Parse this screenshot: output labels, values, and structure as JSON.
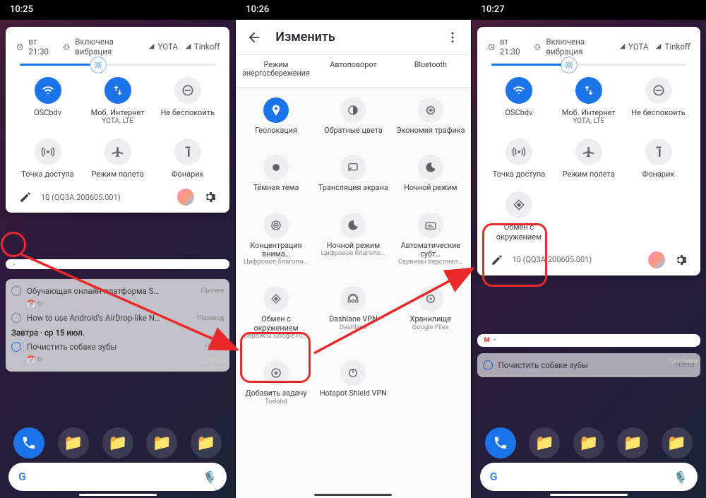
{
  "screen1": {
    "time": "10:25",
    "status": {
      "alarm": "вт 21:30",
      "vibration": "Включена вибрация",
      "carrier1": "YOTA",
      "carrier2": "Tinkoff"
    },
    "tiles": [
      {
        "icon": "wifi",
        "label": "OSCbdv",
        "sub": "",
        "on": true
      },
      {
        "icon": "data",
        "label": "Моб. Интернет",
        "sub": "YOTA, LTE",
        "on": true
      },
      {
        "icon": "dnd",
        "label": "Не беспокоить",
        "sub": "",
        "on": false
      },
      {
        "icon": "hotspot",
        "label": "Точка доступа",
        "sub": "",
        "on": false
      },
      {
        "icon": "airplane",
        "label": "Режим полета",
        "sub": "",
        "on": false
      },
      {
        "icon": "flashlight",
        "label": "Фонарик",
        "sub": "",
        "on": false
      }
    ],
    "build": "10 (QQ3A.200605.001)",
    "tasks": {
      "row1": "Обучающая онлайн-платформа S…",
      "row2": "How to use Android's AirDrop-like N…",
      "row2_meta": "Перевод",
      "date": "Завтра · ср 15 июл.",
      "row3": "Почистить собаке зубы",
      "row3_meta": "Нотка",
      "inbox": "Прочее"
    },
    "system_label": "Система"
  },
  "screen2": {
    "time": "10:26",
    "title": "Изменить",
    "top_row": [
      "Режим энергосбережения",
      "Автоповорот",
      "Bluetooth"
    ],
    "tiles": [
      {
        "icon": "location",
        "label": "Геолокация",
        "sub": "",
        "on": true
      },
      {
        "icon": "invert",
        "label": "Обратные цвета",
        "sub": ""
      },
      {
        "icon": "datasaver",
        "label": "Экономия трафика",
        "sub": ""
      },
      {
        "icon": "dark",
        "label": "Тёмная тема",
        "sub": ""
      },
      {
        "icon": "cast",
        "label": "Трансляция экрана",
        "sub": ""
      },
      {
        "icon": "night",
        "label": "Ночной режим",
        "sub": ""
      },
      {
        "icon": "focus",
        "label": "Концентрация внима…",
        "sub": "Цифровое благопол…"
      },
      {
        "icon": "night2",
        "label": "Ночной режим",
        "sub": "Цифровое благопол…"
      },
      {
        "icon": "caption",
        "label": "Автоматические субт…",
        "sub": "Сервисы персонализ…"
      },
      {
        "icon": "nearby",
        "label": "Обмен с окружением",
        "sub": "Сервисы Google Pla…"
      },
      {
        "icon": "vpn",
        "label": "Dashlane VPN",
        "sub": "Dashlane"
      },
      {
        "icon": "storage",
        "label": "Хранилище",
        "sub": "Google Files"
      },
      {
        "icon": "add",
        "label": "Добавить задачу",
        "sub": "Todoist"
      },
      {
        "icon": "power",
        "label": "Hotspot Shield VPN",
        "sub": ""
      }
    ]
  },
  "screen3": {
    "time": "10:27",
    "status": {
      "alarm": "вт 21:30",
      "vibration": "Включена вибрация",
      "carrier1": "YOTA",
      "carrier2": "Tinkoff"
    },
    "tiles": [
      {
        "icon": "wifi",
        "label": "OSCbdv",
        "sub": "",
        "on": true
      },
      {
        "icon": "data",
        "label": "Моб. Интернет",
        "sub": "YOTA, LTE",
        "on": true
      },
      {
        "icon": "dnd",
        "label": "Не беспокоить",
        "sub": "",
        "on": false
      },
      {
        "icon": "hotspot",
        "label": "Точка доступа",
        "sub": "",
        "on": false
      },
      {
        "icon": "airplane",
        "label": "Режим полета",
        "sub": "",
        "on": false
      },
      {
        "icon": "flashlight",
        "label": "Фонарик",
        "sub": "",
        "on": false
      }
    ],
    "nearby": {
      "label": "Обмен с окружением"
    },
    "build": "10 (QQ3A.200605.001)",
    "task": {
      "text": "Почистить собаке зубы",
      "meta": "Нотка"
    },
    "system_label": "Система"
  }
}
